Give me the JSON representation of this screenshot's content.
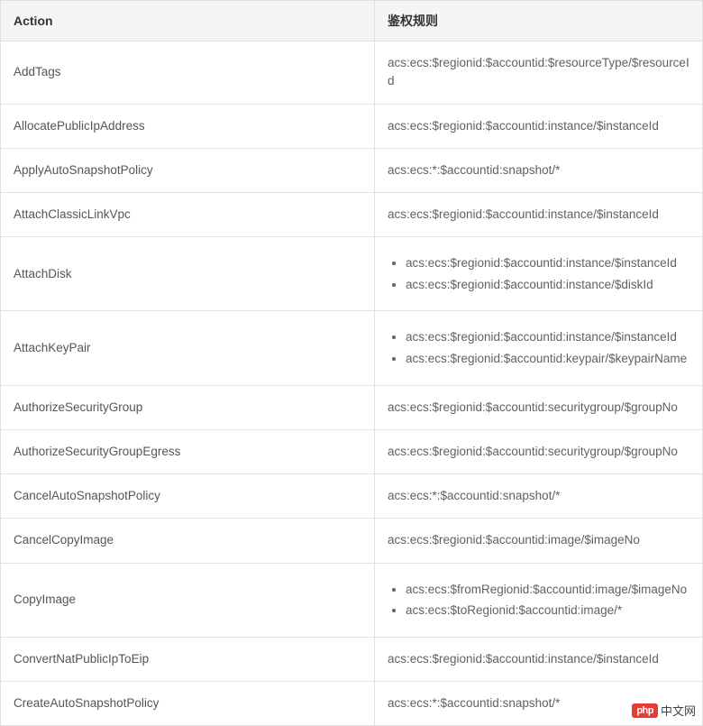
{
  "table": {
    "headers": {
      "action": "Action",
      "rule": "鉴权规则"
    },
    "rows": [
      {
        "action": "AddTags",
        "rules": [
          "acs:ecs:$regionid:$accountid:$resourceType/$resourceId"
        ],
        "list": false
      },
      {
        "action": "AllocatePublicIpAddress",
        "rules": [
          "acs:ecs:$regionid:$accountid:instance/$instanceId"
        ],
        "list": false
      },
      {
        "action": "ApplyAutoSnapshotPolicy",
        "rules": [
          "acs:ecs:*:$accountid:snapshot/*"
        ],
        "list": false
      },
      {
        "action": "AttachClassicLinkVpc",
        "rules": [
          "acs:ecs:$regionid:$accountid:instance/$instanceId"
        ],
        "list": false
      },
      {
        "action": "AttachDisk",
        "rules": [
          "acs:ecs:$regionid:$accountid:instance/$instanceId",
          "acs:ecs:$regionid:$accountid:instance/$diskId"
        ],
        "list": true
      },
      {
        "action": "AttachKeyPair",
        "rules": [
          "acs:ecs:$regionid:$accountid:instance/$instanceId",
          "acs:ecs:$regionid:$accountid:keypair/$keypairName"
        ],
        "list": true
      },
      {
        "action": "AuthorizeSecurityGroup",
        "rules": [
          "acs:ecs:$regionid:$accountid:securitygroup/$groupNo"
        ],
        "list": false
      },
      {
        "action": "AuthorizeSecurityGroupEgress",
        "rules": [
          "acs:ecs:$regionid:$accountid:securitygroup/$groupNo"
        ],
        "list": false
      },
      {
        "action": "CancelAutoSnapshotPolicy",
        "rules": [
          "acs:ecs:*:$accountid:snapshot/*"
        ],
        "list": false
      },
      {
        "action": "CancelCopyImage",
        "rules": [
          "acs:ecs:$regionid:$accountid:image/$imageNo"
        ],
        "list": false
      },
      {
        "action": "CopyImage",
        "rules": [
          "acs:ecs:$fromRegionid:$accountid:image/$imageNo",
          "acs:ecs:$toRegionid:$accountid:image/*"
        ],
        "list": true
      },
      {
        "action": "ConvertNatPublicIpToEip",
        "rules": [
          "acs:ecs:$regionid:$accountid:instance/$instanceId"
        ],
        "list": false
      },
      {
        "action": "CreateAutoSnapshotPolicy",
        "rules": [
          "acs:ecs:*:$accountid:snapshot/*"
        ],
        "list": false
      }
    ]
  },
  "watermark": {
    "logo": "php",
    "text": "中文网"
  }
}
